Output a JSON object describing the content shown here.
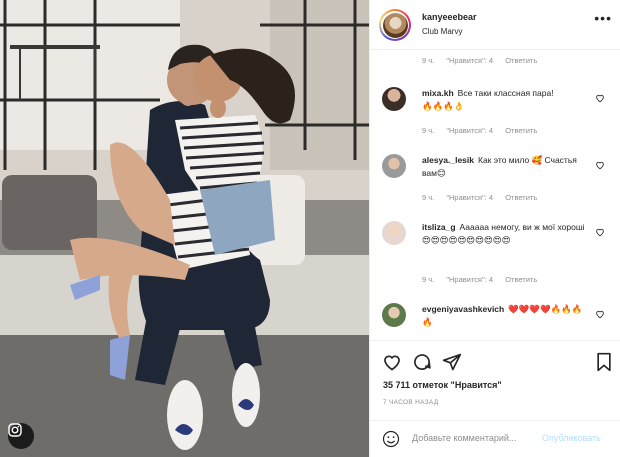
{
  "post": {
    "image": {
      "description_icon": "photo-couple"
    },
    "header": {
      "username": "kanyeeebear",
      "location": "Club Marvy",
      "more_icon": "•••"
    },
    "comments": [
      {
        "meta_time": "9 ч.",
        "meta_likes": "\"Нравится\": 4",
        "meta_reply": "Ответить"
      },
      {
        "username": "mixa.kh",
        "text": "Все таки классная пара!",
        "emoji": "🔥🔥🔥👌",
        "meta_time": "9 ч.",
        "meta_likes": "\"Нравится\": 4",
        "meta_reply": "Ответить"
      },
      {
        "username": "alesya._lesik",
        "text": "Как это мило 🥰 Счастья вам😊",
        "meta_time": "9 ч.",
        "meta_likes": "\"Нравится\": 4",
        "meta_reply": "Ответить"
      },
      {
        "username": "itsliza_g",
        "text": "Аааааа немогу, ви ж мої хороші😍😍😍😍😍😍😍😍😍😍",
        "meta_time": "9 ч.",
        "meta_likes": "\"Нравится\": 4",
        "meta_reply": "Ответить"
      },
      {
        "username": "evgeniyavashkevich",
        "text": "❤️❤️❤️❤️🔥🔥🔥🔥"
      }
    ],
    "likes_text": "35 711 отметок \"Нравится\"",
    "time_ago": "7 ЧАСОВ НАЗАД",
    "add_comment_placeholder": "Добавьте комментарий...",
    "post_button": "Опубликовать",
    "colors": {
      "link_blue_disabled": "#b2dffc",
      "text": "#262626",
      "muted": "#8e8e8e",
      "border": "#efefef"
    }
  }
}
